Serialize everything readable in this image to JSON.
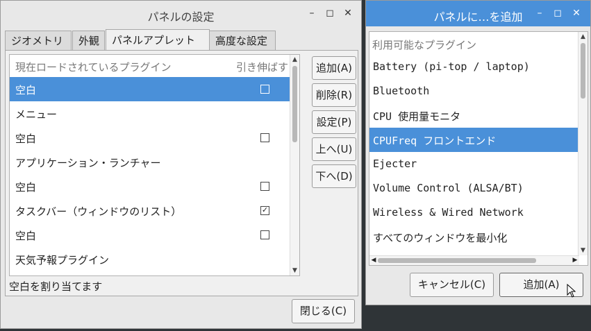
{
  "panel_settings": {
    "title": "パネルの設定",
    "controls": {
      "minimize": "–",
      "maximize": "◻",
      "close": "✕"
    },
    "tabs": [
      {
        "label": "ジオメトリ"
      },
      {
        "label": "外観"
      },
      {
        "label": "パネルアプレット",
        "active": true
      },
      {
        "label": "高度な設定"
      }
    ],
    "list": {
      "headers": {
        "name": "現在ロードされているプラグイン",
        "stretch": "引き伸ばす"
      },
      "rows": [
        {
          "label": "空白",
          "checkbox": true,
          "checked": false,
          "selected": true
        },
        {
          "label": "メニュー",
          "checkbox": false
        },
        {
          "label": "空白",
          "checkbox": true,
          "checked": false
        },
        {
          "label": "アプリケーション・ランチャー",
          "checkbox": false
        },
        {
          "label": "空白",
          "checkbox": true,
          "checked": false
        },
        {
          "label": "タスクバー（ウィンドウのリスト）",
          "checkbox": true,
          "checked": true
        },
        {
          "label": "空白",
          "checkbox": true,
          "checked": false
        },
        {
          "label": "天気予報プラグイン",
          "checkbox": false
        }
      ]
    },
    "buttons": {
      "add": "追加(A)",
      "remove": "削除(R)",
      "settings": "設定(P)",
      "up": "上へ(U)",
      "down": "下へ(D)",
      "close": "閉じる(C)"
    },
    "status": "空白を割り当てます"
  },
  "add_plugin": {
    "title": "パネルに…を追加",
    "controls": {
      "minimize": "–",
      "maximize": "◻",
      "close": "✕"
    },
    "list": {
      "header": "利用可能なプラグイン",
      "rows": [
        {
          "label": "Battery (pi-top / laptop)"
        },
        {
          "label": "Bluetooth"
        },
        {
          "label": "CPU 使用量モニタ"
        },
        {
          "label": "CPUFreq フロントエンド",
          "selected": true
        },
        {
          "label": "Ejecter"
        },
        {
          "label": "Volume Control (ALSA/BT)"
        },
        {
          "label": "Wireless & Wired Network"
        },
        {
          "label": "すべてのウィンドウを最小化"
        }
      ]
    },
    "buttons": {
      "cancel": "キャンセル(C)",
      "add": "追加(A)"
    }
  }
}
